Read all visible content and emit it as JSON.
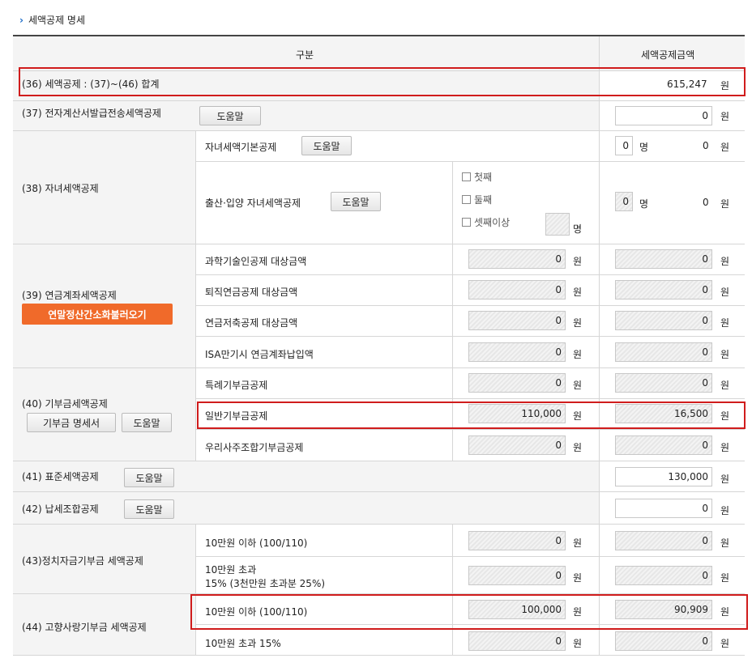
{
  "section_title": "세액공제 명세",
  "header": {
    "col1": "구분",
    "col2": "세액공제금액"
  },
  "won": "원",
  "person": "명",
  "help": "도움말",
  "r36": {
    "label": "(36) 세액공제 : (37)~(46) 합계",
    "amount": "615,247"
  },
  "r37": {
    "label": "(37) 전자계산서발급전송세액공제",
    "amount": "0"
  },
  "r38": {
    "label": "(38) 자녀세액공제",
    "basic_label": "자녀세액기본공제",
    "basic_count": "0",
    "basic_amount": "0",
    "birth_label": "출산·입양 자녀세액공제",
    "birth_count": "0",
    "birth_amount": "0",
    "opt1": "첫째",
    "opt2": "둘째",
    "opt3": "셋째이상"
  },
  "r39": {
    "label": "(39) 연금계좌세액공제",
    "load_button": "연말정산간소화불러오기",
    "rows": [
      {
        "label": "과학기술인공제 대상금액",
        "base": "0",
        "amount": "0"
      },
      {
        "label": "퇴직연금공제 대상금액",
        "base": "0",
        "amount": "0"
      },
      {
        "label": "연금저축공제 대상금액",
        "base": "0",
        "amount": "0"
      },
      {
        "label": "ISA만기시 연금계좌납입액",
        "base": "0",
        "amount": "0"
      }
    ]
  },
  "r40": {
    "label": "(40) 기부금세액공제",
    "detail_button": "기부금 명세서",
    "rows": [
      {
        "label": "특례기부금공제",
        "base": "0",
        "amount": "0"
      },
      {
        "label": "일반기부금공제",
        "base": "110,000",
        "amount": "16,500"
      },
      {
        "label": "우리사주조합기부금공제",
        "base": "0",
        "amount": "0"
      }
    ]
  },
  "r41": {
    "label": "(41) 표준세액공제",
    "amount": "130,000"
  },
  "r42": {
    "label": "(42) 납세조합공제",
    "amount": "0"
  },
  "r43": {
    "label": "(43)정치자금기부금 세액공제",
    "row1": {
      "label": "10만원 이하 (100/110)",
      "base": "0",
      "amount": "0"
    },
    "row2": {
      "label1": "10만원 초과",
      "label2": "15% (3천만원 초과분 25%)",
      "base": "0",
      "amount": "0"
    }
  },
  "r44": {
    "label": "(44) 고향사랑기부금 세액공제",
    "row1": {
      "label": "10만원 이하 (100/110)",
      "base": "100,000",
      "amount": "90,909"
    },
    "row2": {
      "label": "10만원 초과 15%",
      "base": "0",
      "amount": "0"
    }
  }
}
